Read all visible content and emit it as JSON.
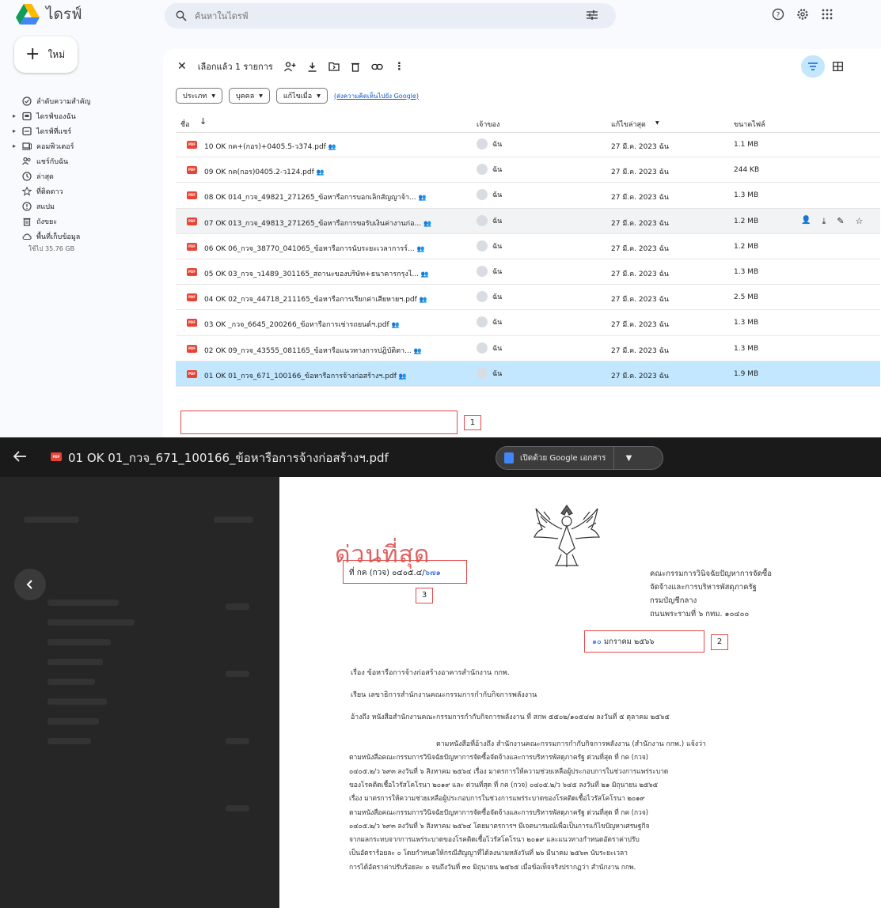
{
  "drive": {
    "app_name": "ไดรฟ์",
    "search": {
      "placeholder": "ค้นหาในไดรฟ์"
    },
    "new_label": "ใหม่",
    "sidebar": {
      "items": [
        {
          "label": "ลำดับความสำคัญ",
          "icon": "check-circle-icon",
          "caret": false
        },
        {
          "label": "ไดรฟ์ของฉัน",
          "icon": "my-drive-icon",
          "caret": true
        },
        {
          "label": "ไดรฟ์ที่แชร์",
          "icon": "shared-drive-icon",
          "caret": true
        },
        {
          "label": "คอมพิวเตอร์",
          "icon": "computer-icon",
          "caret": true
        },
        {
          "label": "แชร์กับฉัน",
          "icon": "people-icon",
          "caret": false
        },
        {
          "label": "ล่าสุด",
          "icon": "clock-icon",
          "caret": false
        },
        {
          "label": "ที่ติดดาว",
          "icon": "star-icon",
          "caret": false
        },
        {
          "label": "สแปม",
          "icon": "spam-icon",
          "caret": false
        },
        {
          "label": "ถังขยะ",
          "icon": "trash-icon",
          "caret": false
        },
        {
          "label": "พื้นที่เก็บข้อมูล",
          "icon": "cloud-icon",
          "caret": false
        }
      ],
      "storage_text": "ใช้ไป 35.76 GB"
    },
    "selection_text": "เลือกแล้ว 1 รายการ",
    "filters": [
      "ประเภท",
      "บุคคล",
      "แก้ไขเมื่อ"
    ],
    "feedback_link": "(ส่งความคิดเห็นไปยัง Google)",
    "columns": {
      "name": "ชื่อ",
      "owner": "เจ้าของ",
      "modified": "แก้ไขล่าสุด",
      "size": "ขนาดไฟล์"
    },
    "files": [
      {
        "name": "10 OK กค+(กอร)+0405.5-ว374.pdf",
        "owner": "ฉัน",
        "modified": "27 มี.ค. 2023 ฉัน",
        "size": "1.1 MB",
        "state": ""
      },
      {
        "name": "09 OK กค(กอร)0405.2-ว124.pdf",
        "owner": "ฉัน",
        "modified": "27 มี.ค. 2023 ฉัน",
        "size": "244 KB",
        "state": ""
      },
      {
        "name": "08 OK 014_กวจ_49821_271265_ข้อหารือการบอกเลิกสัญญาจ้า...",
        "owner": "ฉัน",
        "modified": "27 มี.ค. 2023 ฉัน",
        "size": "1.3 MB",
        "state": ""
      },
      {
        "name": "07 OK 013_กวจ_49813_271265_ข้อหารือการขอรับเงินค่างานก่อ...",
        "owner": "ฉัน",
        "modified": "27 มี.ค. 2023 ฉัน",
        "size": "1.2 MB",
        "state": "hover"
      },
      {
        "name": "06 OK 06_กวจ_38770_041065_ข้อหารือการนับระยะเวลาการร์...",
        "owner": "ฉัน",
        "modified": "27 มี.ค. 2023 ฉัน",
        "size": "1.2 MB",
        "state": ""
      },
      {
        "name": "05 OK 03_กวจ_ว1489_301165_สถานะของบริษัท+ธนาคารกรุงไ...",
        "owner": "ฉัน",
        "modified": "27 มี.ค. 2023 ฉัน",
        "size": "1.3 MB",
        "state": ""
      },
      {
        "name": "04 OK 02_กวจ_44718_211165_ข้อหารือการเรียกค่าเสียหายฯ.pdf",
        "owner": "ฉัน",
        "modified": "27 มี.ค. 2023 ฉัน",
        "size": "2.5 MB",
        "state": ""
      },
      {
        "name": "03 OK _กวจ_6645_200266_ข้อหารือการเช่ารถยนต์ฯ.pdf",
        "owner": "ฉัน",
        "modified": "27 มี.ค. 2023 ฉัน",
        "size": "1.3 MB",
        "state": ""
      },
      {
        "name": "02 OK 09_กวจ_43555_081165_ข้อหารือแนวทางการปฏิบัติตา...",
        "owner": "ฉัน",
        "modified": "27 มี.ค. 2023 ฉัน",
        "size": "1.3 MB",
        "state": ""
      },
      {
        "name": "01 OK 01_กวจ_671_100166_ข้อหารือการจ้างก่อสร้างฯ.pdf",
        "owner": "ฉัน",
        "modified": "27 มี.ค. 2023 ฉัน",
        "size": "1.9 MB",
        "state": "sel"
      }
    ],
    "annotation_1": "1"
  },
  "viewer": {
    "file_icon": "PDF",
    "title": "01 OK 01_กวจ_671_100166_ข้อหารือการจ้างก่อสร้างฯ.pdf",
    "open_with": "เปิดด้วย Google เอกสาร",
    "doc": {
      "urgent": "ด่วนที่สุด",
      "ref_prefix": "ที่ กค (กวจ) ๐๔๐๕.๔/",
      "ref_hand": "๖๗๑",
      "annotation_3": "3",
      "org_lines": [
        "คณะกรรมการวินิจฉัยปัญหาการจัดซื้อ",
        "จัดจ้างและการบริหารพัสดุภาครัฐ",
        "กรมบัญชีกลาง",
        "ถนนพระรามที่ ๖ กทม. ๑๐๔๐๐"
      ],
      "date_hand": "๑๐",
      "date_rest": " มกราคม ๒๕๖๖",
      "annotation_2": "2",
      "subject": "เรื่อง  ข้อหารือการจ้างก่อสร้างอาคารสำนักงาน กกพ.",
      "to": "เรียน  เลขาธิการสำนักงานคณะกรรมการกำกับกิจการพลังงาน",
      "refer": "อ้างถึง  หนังสือสำนักงานคณะกรรมการกำกับกิจการพลังงาน ที่ สกพ ๕๕๐๒/๑๐๕๔๗ ลงวันที่ ๕ ตุลาคม ๒๕๖๕",
      "body": [
        "ตามหนังสือที่อ้างถึง สำนักงานคณะกรรมการกำกับกิจการพลังงาน (สำนักงาน กกพ.) แจ้งว่า",
        "ตามหนังสือคณะกรรมการวินิจฉัยปัญหาการจัดซื้อจัดจ้างและการบริหารพัสดุภาครัฐ ด่วนที่สุด ที่ กค (กวจ)",
        "๐๔๐๕.๒/ว ๖๙๓ ลงวันที่ ๖ สิงหาคม ๒๕๖๔ เรื่อง มาตรการให้ความช่วยเหลือผู้ประกอบการในช่วงการแพร่ระบาด",
        "ของโรคติดเชื้อไวรัสโคโรนา ๒๐๑๙ และ ด่วนที่สุด ที่ กค (กวจ) ๐๔๐๕.๒/ว ๖๔๕ ลงวันที่ ๒๑ มิถุนายน ๒๕๖๕",
        "เรื่อง มาตรการให้ความช่วยเหลือผู้ประกอบการในช่วงการแพร่ระบาดของโรคติดเชื้อไวรัสโคโรนา ๒๐๑๙",
        "ตามหนังสือคณะกรรมการวินิจฉัยปัญหาการจัดซื้อจัดจ้างและการบริหารพัสดุภาครัฐ ด่วนที่สุด ที่ กค (กวจ)",
        "๐๔๐๕.๒/ว ๖๙๓ ลงวันที่ ๖ สิงหาคม ๒๕๖๔ โดยมาตรการฯ มีเจตนารมณ์เพื่อเป็นการแก้ไขปัญหาเศรษฐกิจ",
        "จากผลกระทบจากการแพร่ระบาดของโรคติดเชื้อไวรัสโคโรนา ๒๐๑๙ และแนวทางกำหนดอัตราค่าปรับ",
        "เป็นอัตราร้อยละ ๐ โดยกำหนดให้กรณีสัญญาที่ได้ลงนามหลังวันที่ ๒๖ มีนาคม ๒๕๖๓ นับระยะเวลา",
        "การได้อัตราค่าปรับร้อยละ ๐ จนถึงวันที่ ๓๐ มิถุนายน ๒๕๖๕ เมื่อข้อเท็จจริงปรากฏว่า สำนักงาน กกพ."
      ]
    }
  }
}
